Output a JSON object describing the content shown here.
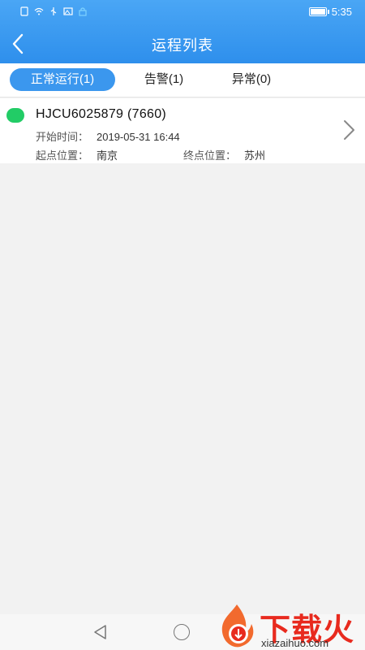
{
  "status_bar": {
    "time": "5:35",
    "icons": [
      "sim-icon",
      "wifi-icon",
      "usb-icon",
      "image-icon",
      "lock-icon"
    ],
    "battery_level": 0.9
  },
  "header": {
    "title": "运程列表",
    "background": "#2e8fec"
  },
  "tabs": [
    {
      "label": "正常运行(1)",
      "active": true
    },
    {
      "label": "告警(1)",
      "active": false
    },
    {
      "label": "异常(0)",
      "active": false
    }
  ],
  "trips": [
    {
      "status_color": "#22cc66",
      "code": "HJCU6025879  (7660)",
      "start_time_label": "开始时间：",
      "start_time": "2019-05-31 16:44",
      "start_pos_label": "起点位置：",
      "start_pos": "南京",
      "end_pos_label": "终点位置：",
      "end_pos": "苏州"
    }
  ],
  "watermark": {
    "title": "下载火",
    "subtitle": "xiazaihuo.com"
  }
}
